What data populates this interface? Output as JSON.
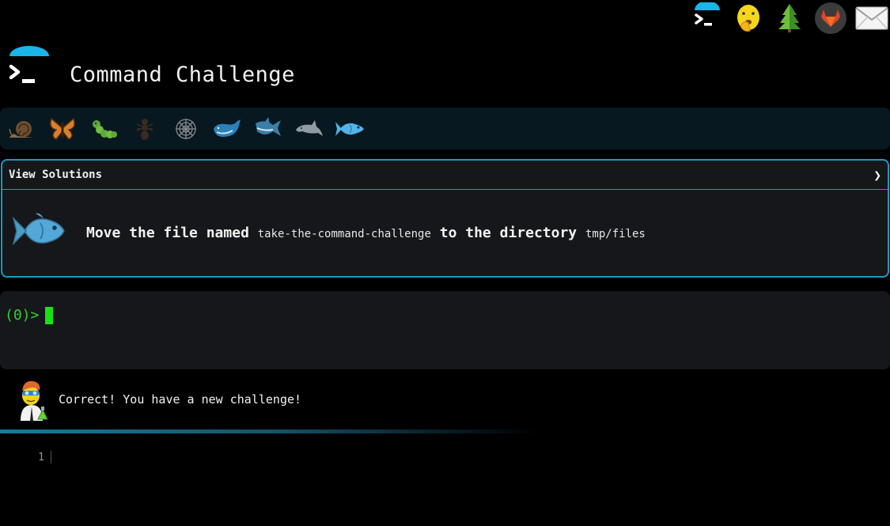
{
  "app": {
    "title": "Command Challenge"
  },
  "topbar": {
    "icons": [
      "terminal-icon",
      "shushing-face-icon",
      "tree-icon",
      "gitlab-icon",
      "mail-icon"
    ]
  },
  "levels": {
    "icons": [
      "snail-icon",
      "butterfly-icon",
      "caterpillar-icon",
      "ant-icon",
      "spider-web-icon",
      "whale-icon",
      "shark-icon",
      "dolphin-icon",
      "fish-icon"
    ],
    "active_index": 8
  },
  "challenge": {
    "view_solutions_label": "View Solutions",
    "expand_chevron": "❯",
    "task_prefix": "Move the file named",
    "task_file": "take-the-command-challenge",
    "task_middle": "to the directory",
    "task_dir": "tmp/files"
  },
  "terminal": {
    "prompt": "(0)>"
  },
  "feedback": {
    "message": "Correct! You have a new challenge!"
  },
  "editor": {
    "line_number": "1"
  },
  "colors": {
    "accent": "#1a9bc4",
    "prompt": "#2fd22f",
    "panel": "#16171a"
  }
}
